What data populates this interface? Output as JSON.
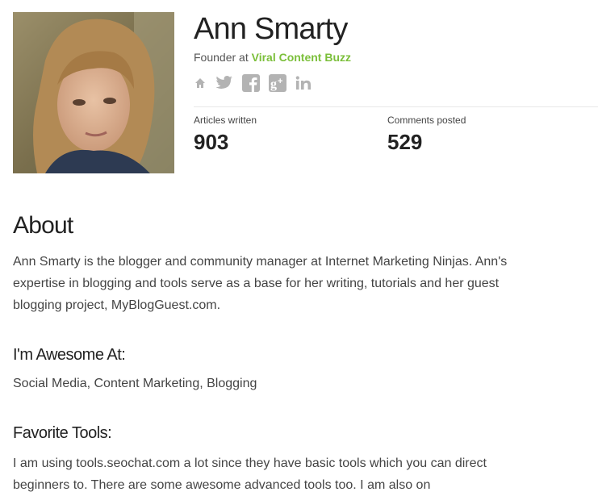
{
  "profile": {
    "name": "Ann Smarty",
    "role_prefix": "Founder at ",
    "company": "Viral Content Buzz",
    "social_icons": [
      "home-icon",
      "twitter-icon",
      "facebook-icon",
      "google-plus-icon",
      "linkedin-icon"
    ]
  },
  "stats": {
    "articles_label": "Articles written",
    "articles_value": "903",
    "comments_label": "Comments posted",
    "comments_value": "529"
  },
  "about": {
    "title": "About",
    "lines": [
      "Ann Smarty is the blogger and community manager at Internet Marketing Ninjas. Ann's",
      "expertise in blogging and tools serve as a base for her writing, tutorials and her guest",
      "blogging project, MyBlogGuest.com."
    ]
  },
  "awesome": {
    "title": "I'm Awesome At:",
    "text": "Social Media, Content Marketing, Blogging"
  },
  "tools": {
    "title": "Favorite Tools:",
    "lines": [
      "I am using tools.seochat.com a lot since they have basic tools which you can direct",
      "beginners to. There are some awesome advanced tools too. I am also on"
    ]
  },
  "colors": {
    "link": "#7bbf3a",
    "icon": "#b3b3b3"
  }
}
